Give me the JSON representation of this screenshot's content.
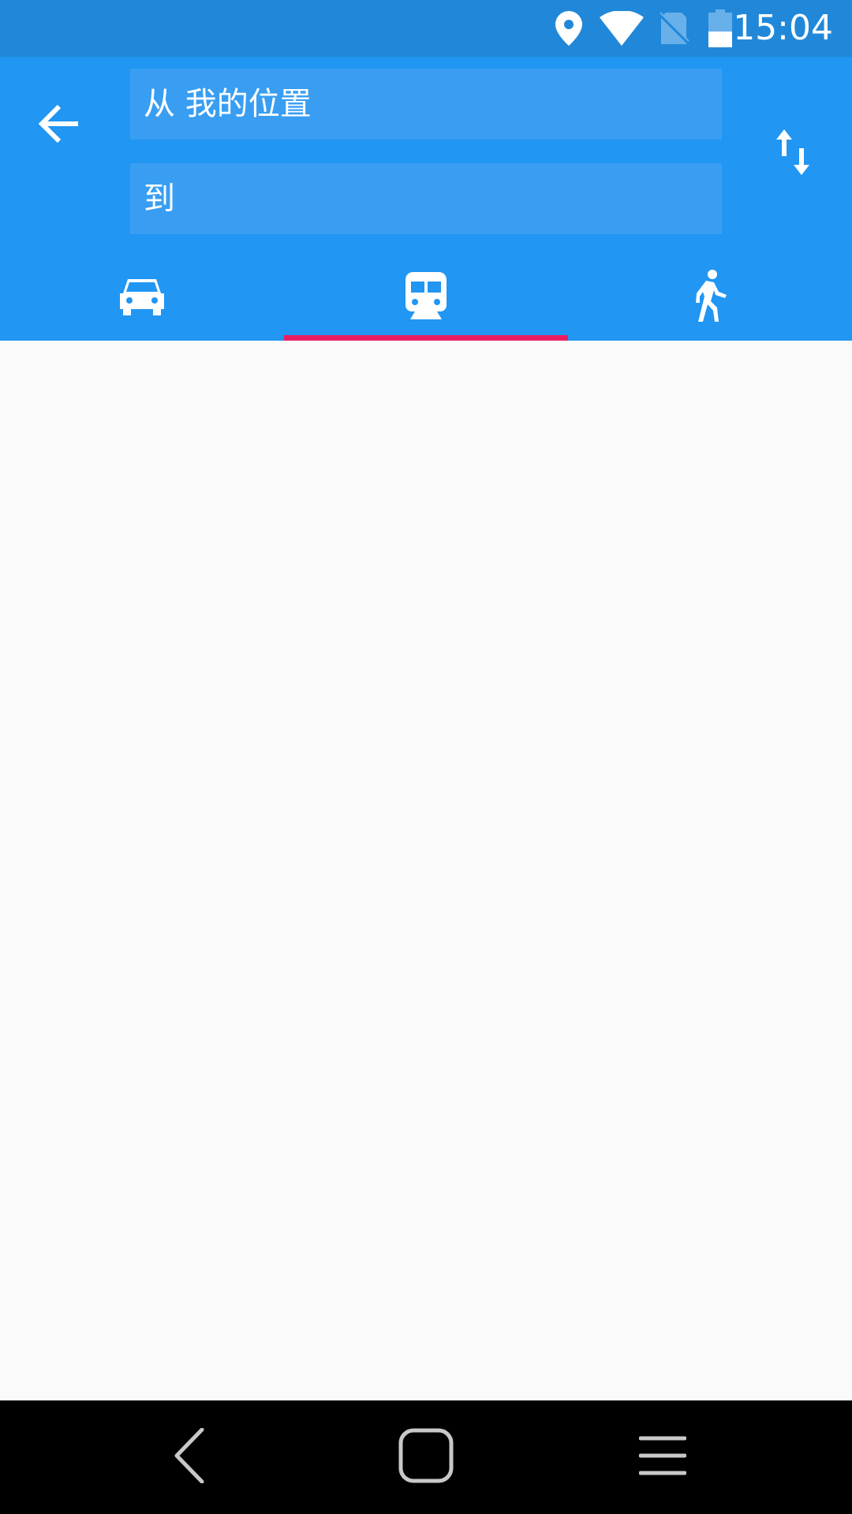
{
  "status_bar": {
    "time": "15:04",
    "icons": [
      "location-icon",
      "wifi-icon",
      "no-sim-icon",
      "battery-icon"
    ]
  },
  "route": {
    "from_label": "从",
    "from_value": "我的位置",
    "from_text": "从 我的位置",
    "to_text": "到"
  },
  "tabs": [
    {
      "name": "driving",
      "icon": "car-icon",
      "selected": false
    },
    {
      "name": "transit",
      "icon": "train-icon",
      "selected": true
    },
    {
      "name": "walking",
      "icon": "walk-icon",
      "selected": false
    }
  ],
  "colors": {
    "status_bar": "#2188d9",
    "app_bar": "#2196f3",
    "field_bg": "#399ef2",
    "tab_indicator": "#e91e63",
    "content_bg": "#fafafa",
    "nav_bar": "#000000"
  },
  "nav_bar": {
    "icons": [
      "back-icon",
      "home-icon",
      "menu-icon"
    ]
  }
}
